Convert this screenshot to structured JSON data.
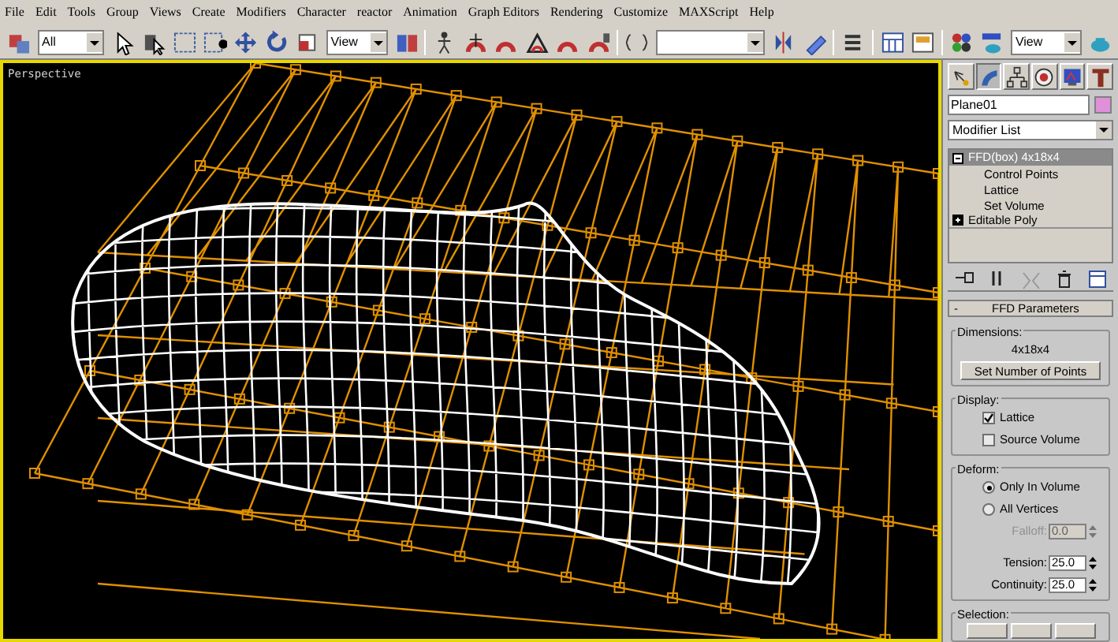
{
  "menu": [
    "File",
    "Edit",
    "Tools",
    "Group",
    "Views",
    "Create",
    "Modifiers",
    "Character",
    "reactor",
    "Animation",
    "Graph Editors",
    "Rendering",
    "Customize",
    "MAXScript",
    "Help"
  ],
  "toolbar": {
    "selection_filter": "All",
    "reference_coord": "View",
    "render_view": "View"
  },
  "viewport": {
    "label": "Perspective"
  },
  "command_panel": {
    "tabs": [
      {
        "kind": "create",
        "selected": false
      },
      {
        "kind": "modify",
        "selected": true
      },
      {
        "kind": "hierarchy",
        "selected": false
      },
      {
        "kind": "motion",
        "selected": false
      },
      {
        "kind": "display",
        "selected": false
      },
      {
        "kind": "utilities",
        "selected": false
      }
    ],
    "object_name": "Plane01",
    "modifier_list": "Modifier List",
    "stack": [
      {
        "label": "FFD(box) 4x18x4",
        "selected": true,
        "expanded": true,
        "children": [
          {
            "label": "Control Points"
          },
          {
            "label": "Lattice"
          },
          {
            "label": "Set Volume"
          }
        ]
      },
      {
        "label": "Editable Poly",
        "selected": false,
        "expanded": false
      }
    ],
    "rollout": {
      "toggle": "-",
      "title": "FFD Parameters",
      "dimensions": {
        "title": "Dimensions:",
        "value": "4x18x4",
        "button": "Set Number of Points"
      },
      "display": {
        "title": "Display:",
        "options": [
          {
            "label": "Lattice",
            "checked": true
          },
          {
            "label": "Source Volume",
            "checked": false
          }
        ]
      },
      "deform": {
        "title": "Deform:",
        "options": [
          {
            "label": "Only In Volume",
            "selected": true
          },
          {
            "label": "All Vertices",
            "selected": false
          }
        ],
        "spinners": [
          {
            "label": "Falloff:",
            "value": "0.0",
            "disabled": true
          },
          {
            "label": "Tension:",
            "value": "25.0",
            "disabled": false
          },
          {
            "label": "Continuity:",
            "value": "25.0",
            "disabled": false
          }
        ]
      },
      "selection": {
        "title": "Selection:"
      }
    }
  }
}
